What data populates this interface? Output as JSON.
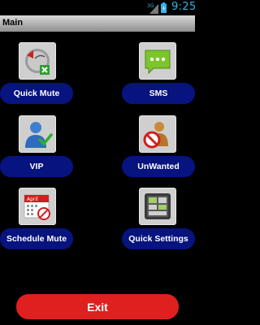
{
  "status_bar": {
    "network_label": "3G",
    "time": "9:25",
    "icons": [
      "signal-icon",
      "battery-icon"
    ]
  },
  "title_bar": {
    "title": "Main"
  },
  "grid": [
    {
      "label": "Quick Mute",
      "icon": "quick-mute-icon"
    },
    {
      "label": "SMS",
      "icon": "sms-icon"
    },
    {
      "label": "VIP",
      "icon": "vip-contact-icon"
    },
    {
      "label": "UnWanted",
      "icon": "unwanted-contact-icon"
    },
    {
      "label": "Schedule Mute",
      "icon": "calendar-icon",
      "icon_text": "April"
    },
    {
      "label": "Quick Settings",
      "icon": "quick-settings-icon"
    }
  ],
  "exit_button": {
    "label": "Exit"
  },
  "colors": {
    "pill": "#07137f",
    "exit": "#e01f1f",
    "time": "#33b5e5",
    "icon_bg": "#cfcfcf"
  }
}
